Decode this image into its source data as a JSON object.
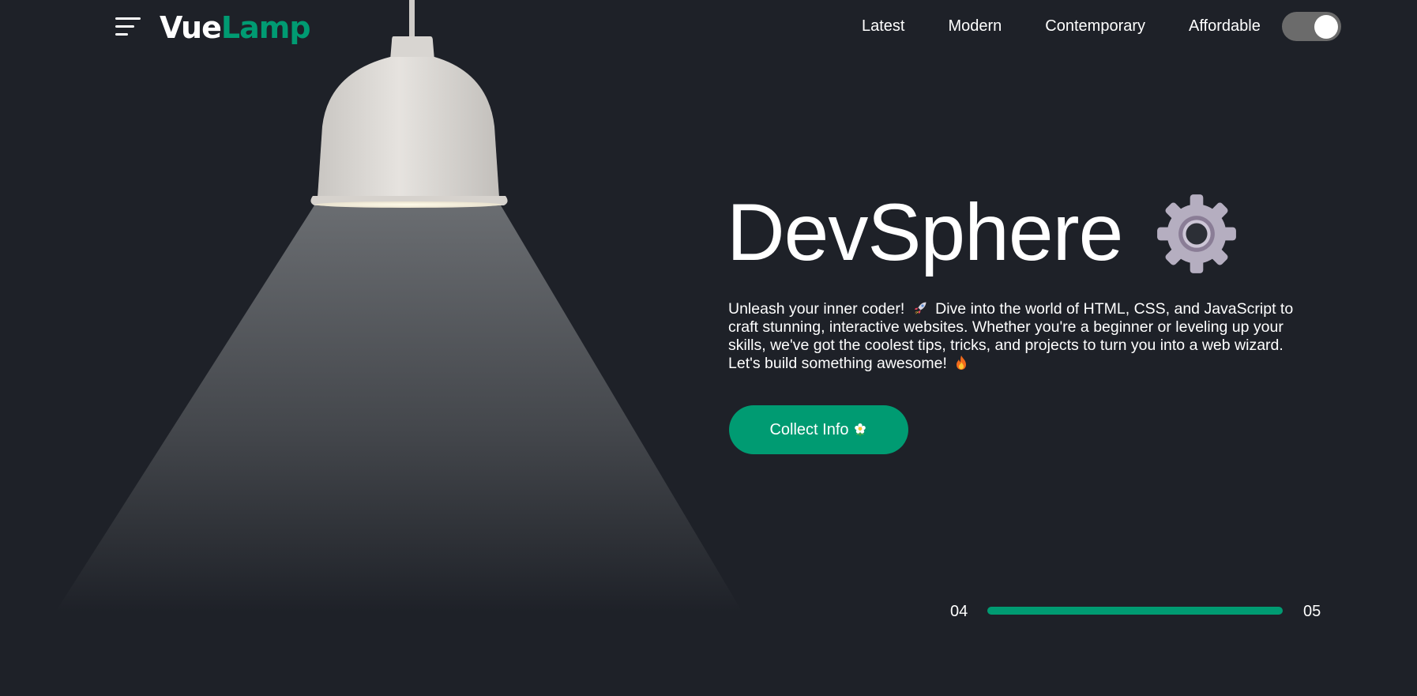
{
  "brand": {
    "logo_part1": "Vue",
    "logo_part2": "Lamp",
    "accent_color": "#009b72",
    "background_color": "#1e2128"
  },
  "header": {
    "menu_icon": "hamburger-menu-icon",
    "nav": [
      "Latest",
      "Modern",
      "Contemporary",
      "Affordable"
    ],
    "theme_toggle": {
      "state": "on"
    }
  },
  "hero": {
    "title": "DevSphere",
    "title_icon": "gear-icon",
    "desc_part1": "Unleash your inner coder!",
    "desc_emoji1": "rocket-icon",
    "desc_part2": "Dive into the world of HTML, CSS, and JavaScript to craft stunning, interactive websites. Whether you're a beginner or leveling up your skills, we've got the coolest tips, tricks, and projects to turn you into a web wizard. Let's build something awesome!",
    "desc_emoji2": "fire-icon",
    "cta_label": "Collect Info",
    "cta_emoji": "flower-icon"
  },
  "slider": {
    "current": "04",
    "total": "05",
    "progress": 1.0
  }
}
